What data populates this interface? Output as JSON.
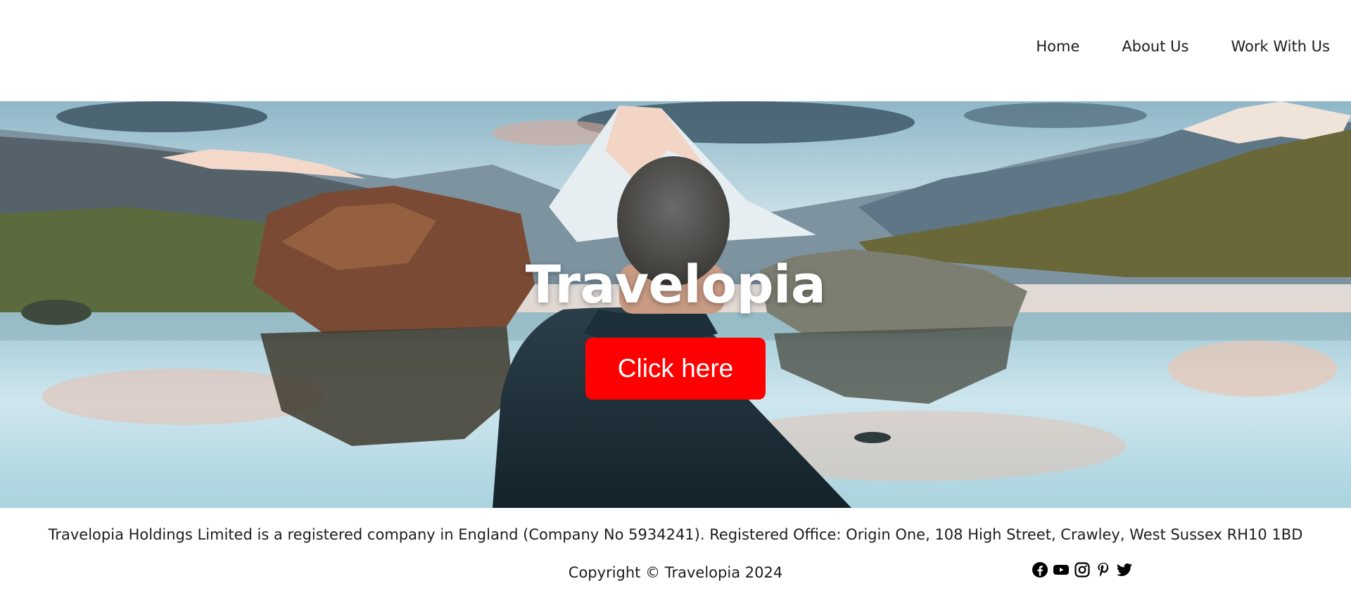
{
  "nav": {
    "items": [
      {
        "label": "Home"
      },
      {
        "label": "About Us"
      },
      {
        "label": "Work With Us"
      }
    ]
  },
  "hero": {
    "title": "Travelopia",
    "button_label": "Click here",
    "button_color": "#ff0000"
  },
  "footer": {
    "legal": "Travelopia Holdings Limited is a registered company in England (Company No 5934241). Registered Office: Origin One, 108 High Street, Crawley, West Sussex RH10 1BD",
    "copyright": "Copyright © Travelopia 2024",
    "socials": [
      "facebook-icon",
      "youtube-icon",
      "instagram-icon",
      "pinterest-icon",
      "twitter-icon"
    ]
  }
}
